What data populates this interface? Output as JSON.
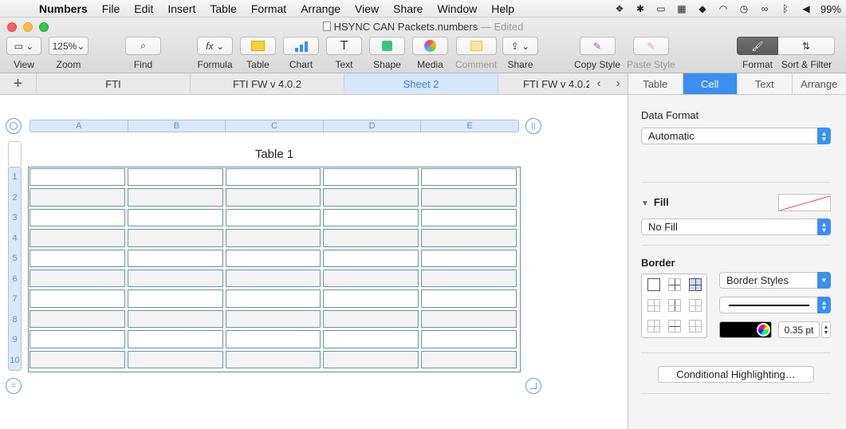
{
  "menubar": {
    "app": "Numbers",
    "items": [
      "File",
      "Edit",
      "Insert",
      "Table",
      "Format",
      "Arrange",
      "View",
      "Share",
      "Window",
      "Help"
    ],
    "battery": "99%"
  },
  "window": {
    "title": "HSYNC CAN Packets.numbers",
    "edited": "— Edited"
  },
  "toolbar": {
    "view": "View",
    "zoom_value": "125%",
    "zoom": "Zoom",
    "find": "Find",
    "formula": "Formula",
    "table": "Table",
    "chart": "Chart",
    "text": "Text",
    "shape": "Shape",
    "media": "Media",
    "comment": "Comment",
    "share": "Share",
    "copy_style": "Copy Style",
    "paste_style": "Paste Style",
    "format": "Format",
    "sort_filter": "Sort & Filter"
  },
  "sheets": {
    "tabs": [
      "FTI",
      "FTI FW v 4.0.2",
      "Sheet 2",
      "FTI FW v 4.0.2"
    ],
    "active_index": 2
  },
  "table": {
    "title": "Table 1",
    "columns": [
      "A",
      "B",
      "C",
      "D",
      "E"
    ],
    "rows": [
      "1",
      "2",
      "3",
      "4",
      "5",
      "6",
      "7",
      "8",
      "9",
      "10"
    ]
  },
  "inspector": {
    "tabs": [
      "Table",
      "Cell",
      "Text",
      "Arrange"
    ],
    "active_tab": "Cell",
    "data_format_label": "Data Format",
    "data_format_value": "Automatic",
    "fill_label": "Fill",
    "fill_value": "No Fill",
    "border_label": "Border",
    "border_styles": "Border Styles",
    "border_width": "0.35 pt",
    "conditional": "Conditional Highlighting…"
  }
}
